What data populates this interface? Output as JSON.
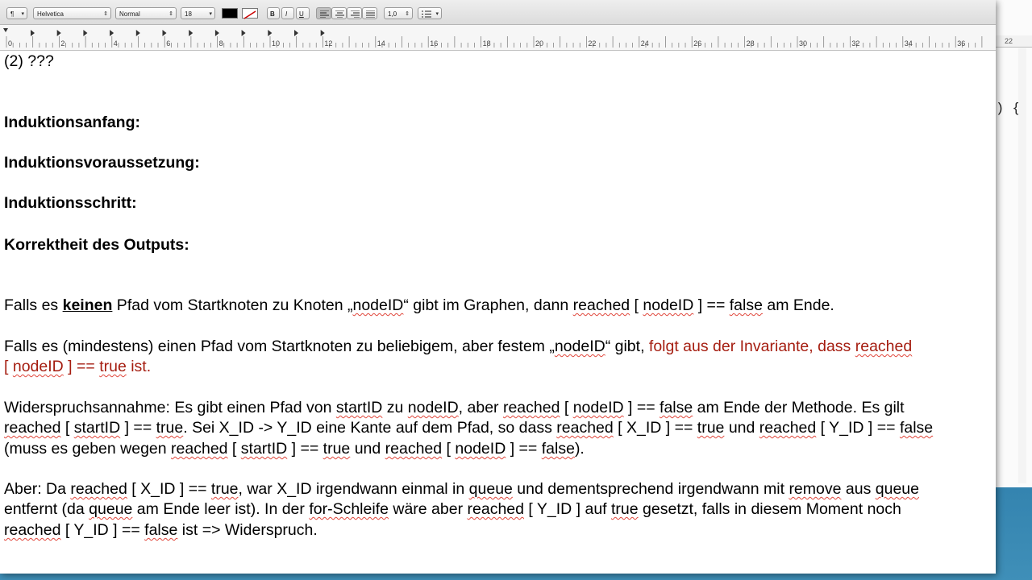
{
  "toolbar": {
    "paragraph_style": "¶",
    "font_family": "Helvetica",
    "font_style": "Normal",
    "font_size": "18",
    "bold": "B",
    "italic": "I",
    "underline": "U",
    "line_spacing": "1,0",
    "text_color": "#000000",
    "highlight_color": "#ffffff"
  },
  "ruler": {
    "labels": [
      "0",
      "2",
      "4",
      "6",
      "8",
      "10",
      "12",
      "14",
      "16",
      "18",
      "20",
      "22",
      "24",
      "26",
      "28",
      "30",
      "32",
      "34",
      "36"
    ],
    "tab_stops": 12
  },
  "background_window": {
    "ruler_label": "22",
    "code_fragment": ") {"
  },
  "document": {
    "line1": "(2) ???",
    "h_anfang": "Induktionsanfang:",
    "h_voraussetzung": "Induktionsvoraussetzung:",
    "h_schritt": "Induktionsschritt:",
    "h_korrektheit": "Korrektheit des Outputs:",
    "p1": {
      "a": "Falls es ",
      "keinen": "keinen",
      "b": " Pfad vom Startknoten zu Knoten „",
      "nodeID": "nodeID",
      "c": "“ gibt im Graphen, dann  ",
      "reached": "reached",
      "d": " [ ",
      "nodeID2": "nodeID",
      "e": " ] == ",
      "false": "false",
      "f": " am Ende."
    },
    "p2": {
      "a": "Falls es (mindestens) einen Pfad vom Startknoten zu  beliebigem, aber festem „",
      "nodeID": "nodeID",
      "b": "“ gibt, ",
      "red1": "folgt aus der Invariante, dass ",
      "reached": "reached",
      "red2_a": "[ ",
      "nodeID2": "nodeID",
      "red2_b": " ] == ",
      "true": "true",
      "red2_c": " ist."
    },
    "p3": {
      "l1_a": "Widerspruchsannahme: Es gibt einen Pfad von ",
      "startID": "startID",
      "l1_b": " zu ",
      "nodeID": "nodeID",
      "l1_c": ", aber ",
      "reached": "reached",
      "l1_d": " [ ",
      "nodeID2": "nodeID",
      "l1_e": " ] == ",
      "false": "false",
      "l1_f": " am Ende der Methode. Es gilt",
      "l2_reached": "reached",
      "l2_a": " [ ",
      "l2_startID": "startID",
      "l2_b": " ] == ",
      "l2_true": "true",
      "l2_c": ". Sei X_ID -> Y_ID eine Kante auf dem Pfad, so dass ",
      "l2_reached2": "reached",
      "l2_d": " [ X_ID ] == ",
      "l2_true2": "true",
      "l2_e": " und ",
      "l2_reached3": "reached",
      "l2_f": " [ Y_ID ] == ",
      "l2_false": "false",
      "l3_a": "(muss es geben wegen ",
      "l3_reached": "reached",
      "l3_b": " [ ",
      "l3_startID": "startID",
      "l3_c": " ] == ",
      "l3_true": "true",
      "l3_d": " und ",
      "l3_reached2": "reached",
      "l3_e": " [ ",
      "l3_nodeID": "nodeID",
      "l3_f": " ] == ",
      "l3_false": "false",
      "l3_g": ")."
    },
    "p4": {
      "l1_a": "Aber: Da ",
      "l1_reached": "reached",
      "l1_b": " [ X_ID ] == ",
      "l1_true": "true",
      "l1_c": ", war X_ID irgendwann einmal in ",
      "l1_queue": "queue",
      "l1_d": " und dementsprechend irgendwann mit ",
      "l1_remove": "remove",
      "l1_e": " aus ",
      "l1_queue2": "queue",
      "l2_a": "entfernt (da ",
      "l2_queue": "queue",
      "l2_b": " am Ende leer ist). In der ",
      "l2_for": "for-Schleife",
      "l2_c": " wäre aber ",
      "l2_reached": "reached",
      "l2_d": " [ Y_ID ] auf ",
      "l2_true": "true",
      "l2_e": " gesetzt, falls in diesem Moment noch",
      "l3_reached": "reached",
      "l3_a": " [ Y_ID ] == ",
      "l3_false": "false",
      "l3_b": " ist => Widerspruch."
    }
  }
}
